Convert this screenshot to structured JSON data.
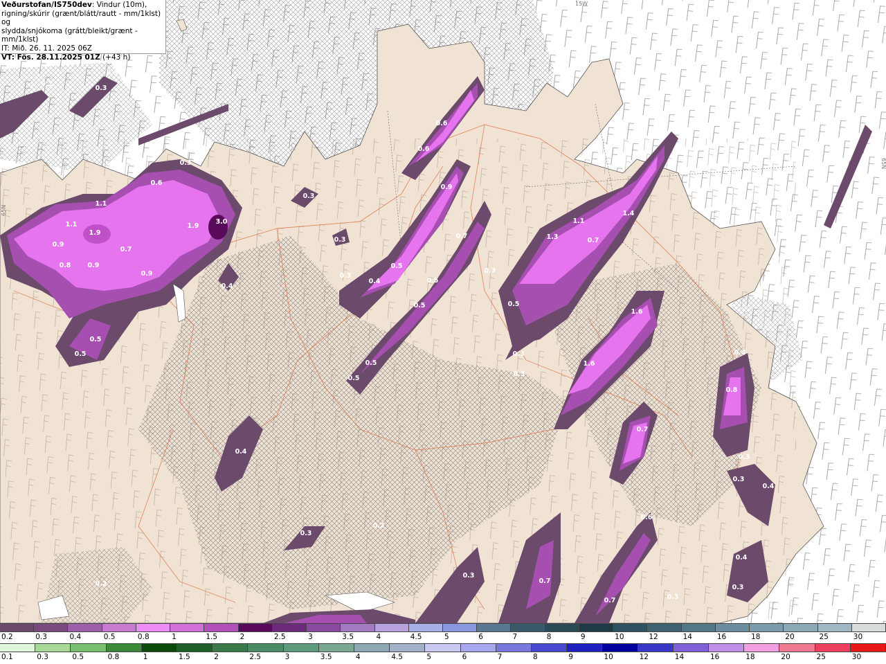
{
  "header": {
    "source": "Veðurstofan/IS750dev",
    "line1": ": Vindur (10m),",
    "line2": "rigning/skúrir (grænt/blátt/rautt - mm/1klst) og",
    "line3": "slydda/snjókoma (grátt/bleikt/grænt - mm/1klst)",
    "issued": "IT: Mið. 26. 11. 2025 06Z",
    "valid_prefix": "VT: Fös. 28.11.2025 01Z",
    "valid_suffix": "(+43 h)"
  },
  "map_labels": {
    "top_coord": "15W",
    "left_coord": "65N",
    "right_coord": "65N"
  },
  "precip_values": [
    "0.3",
    "0.2",
    "0.3",
    "0.3",
    "0.6",
    "1.1",
    "1.1",
    "1.9",
    "0.9",
    "0.8",
    "0.9",
    "0.7",
    "0.9",
    "1.9",
    "3.0",
    "0.5",
    "0.5",
    "0.4",
    "0.3",
    "0.3",
    "0.3",
    "0.4",
    "0.5",
    "0.6",
    "0.6",
    "0.9",
    "0.7",
    "0.5",
    "0.5",
    "0.5",
    "0.5",
    "0.3",
    "1.3",
    "1.1",
    "0.7",
    "1.4",
    "0.5",
    "1.6",
    "1.6",
    "0.3",
    "0.4",
    "0.8",
    "0.7",
    "0.4",
    "0.3",
    "0.4",
    "0.6",
    "0.3",
    "0.2",
    "0.3",
    "0.7",
    "0.7",
    "0.3",
    "0.4",
    "0.3",
    "0.3",
    "0.2",
    "0.3"
  ],
  "colors": {
    "land": "#f0e3d4",
    "sea": "#ffffff",
    "snow_light": "#6b4a6b",
    "snow_mid": "#a64fb0",
    "snow_high": "#e774ef",
    "snow_max": "#5a0a5a",
    "roads": "#e07a50",
    "wind_barb": "#888888"
  },
  "legend": {
    "snow": {
      "labels": [
        "0.2",
        "0.3",
        "0.4",
        "0.5",
        "0.8",
        "1",
        "1.5",
        "2",
        "2.5",
        "3",
        "3.5",
        "4",
        "4.5",
        "5",
        "6",
        "7",
        "8",
        "9",
        "10",
        "12",
        "14",
        "16",
        "18",
        "20",
        "25",
        "30"
      ],
      "colors": [
        "#6b4a6b",
        "#7a4a7f",
        "#9c5fa8",
        "#c77ad0",
        "#ee8cf5",
        "#d070d8",
        "#b050b8",
        "#5a0a5a",
        "#6e2a7a",
        "#8a4aa0",
        "#a27ac2",
        "#b8a0dc",
        "#a8b0e8",
        "#8898e0",
        "#5a7890",
        "#3a5a6a",
        "#2a4a58",
        "#1e3a48",
        "#2e5260",
        "#3e6272",
        "#527888",
        "#6a8ea0",
        "#7c9cac",
        "#8ca8b6",
        "#a0b8c4",
        "#d8dcdc"
      ]
    },
    "rain": {
      "labels": [
        "0.1",
        "0.3",
        "0.5",
        "0.8",
        "1",
        "1.5",
        "2",
        "2.5",
        "3",
        "3.5",
        "4",
        "4.5",
        "5",
        "6",
        "7",
        "8",
        "9",
        "10",
        "12",
        "14",
        "16",
        "18",
        "20",
        "25",
        "30"
      ],
      "colors": [
        "#dff5dc",
        "#a8d898",
        "#78c070",
        "#3a8a3a",
        "#0a4a0a",
        "#1e5e28",
        "#3a7a4a",
        "#4a8a64",
        "#5e9a7c",
        "#7aa892",
        "#8ea8b4",
        "#a2b0c8",
        "#c8c8f0",
        "#a8a8f0",
        "#7878e0",
        "#4848d0",
        "#2020c0",
        "#0000a0",
        "#3838c8",
        "#8060d8",
        "#c090e8",
        "#f0a0e0",
        "#f07890",
        "#f04060",
        "#e81818"
      ]
    }
  }
}
